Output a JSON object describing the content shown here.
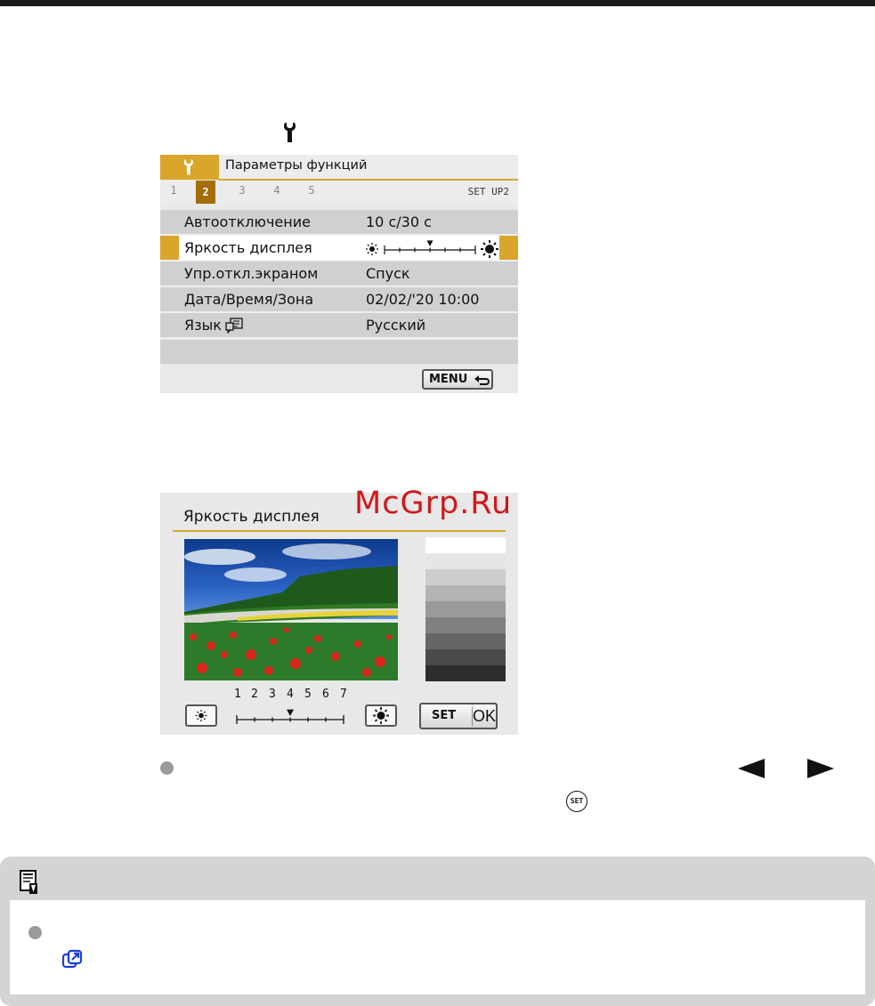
{
  "screen1": {
    "header_title": "Параметры функций",
    "tabs": [
      "1",
      "2",
      "3",
      "4",
      "5"
    ],
    "active_tab": "2",
    "tab_caption": "SET UP2",
    "rows": [
      {
        "label": "Автоотключение",
        "value": "10 с/30 с"
      },
      {
        "label": "Яркость дисплея",
        "value": ""
      },
      {
        "label": "Упр.откл.экраном",
        "value": "Спуск"
      },
      {
        "label": "Дата/Время/Зона",
        "value": "02/02/'20 10:00"
      },
      {
        "label": "Язык",
        "value": "Русский"
      }
    ],
    "brightness_level": 4,
    "brightness_max": 7,
    "menu_button": "MENU"
  },
  "screen2": {
    "title": "Яркость дисплея",
    "scale_numbers": [
      "1",
      "2",
      "3",
      "4",
      "5",
      "6",
      "7"
    ],
    "level": 4,
    "set_label": "SET",
    "ok_label": "OK",
    "gray_steps": [
      "#ffffff",
      "#e6e6e6",
      "#cdcdcd",
      "#b3b3b3",
      "#9a9a9a",
      "#808080",
      "#666666",
      "#4a4a4a",
      "#2c2c2c"
    ]
  },
  "watermark": "McGrp.Ru",
  "set_symbol": "SET",
  "colors": {
    "accent": "#d9a52b",
    "active_tab": "#a46d07",
    "watermark": "#d0181e"
  },
  "icons": [
    "wrench-icon",
    "sun-low-icon",
    "sun-high-icon",
    "return-arrow-icon",
    "arrow-left-icon",
    "arrow-right-icon",
    "set-button-icon",
    "note-icon",
    "link-icon",
    "language-icon"
  ]
}
